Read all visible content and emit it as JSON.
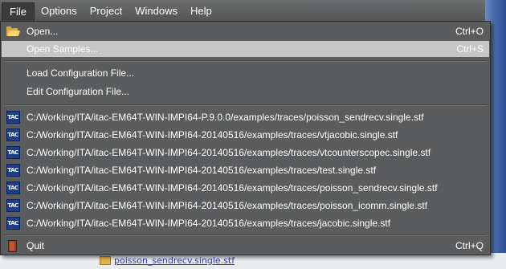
{
  "menubar": {
    "items": [
      {
        "label": "File",
        "active": true
      },
      {
        "label": "Options"
      },
      {
        "label": "Project"
      },
      {
        "label": "Windows"
      },
      {
        "label": "Help"
      }
    ]
  },
  "file_menu": {
    "open": {
      "label": "Open...",
      "shortcut": "Ctrl+O",
      "icon": "folder-open-icon"
    },
    "open_samples": {
      "label": "Open Samples...",
      "shortcut": "Ctrl+S",
      "highlighted": true
    },
    "load_config": {
      "label": "Load Configuration File..."
    },
    "edit_config": {
      "label": "Edit Configuration File..."
    },
    "recent_files": [
      {
        "label": "C:/Working/ITA/itac-EM64T-WIN-IMPI64-P.9.0.0/examples/traces/poisson_sendrecv.single.stf"
      },
      {
        "label": "C:/Working/ITA/itac-EM64T-WIN-IMPI64-20140516/examples/traces/vtjacobic.single.stf"
      },
      {
        "label": "C:/Working/ITA/itac-EM64T-WIN-IMPI64-20140516/examples/traces/vtcounterscopec.single.stf"
      },
      {
        "label": "C:/Working/ITA/itac-EM64T-WIN-IMPI64-20140516/examples/traces/test.single.stf"
      },
      {
        "label": "C:/Working/ITA/itac-EM64T-WIN-IMPI64-20140516/examples/traces/poisson_sendrecv.single.stf"
      },
      {
        "label": "C:/Working/ITA/itac-EM64T-WIN-IMPI64-20140516/examples/traces/poisson_icomm.single.stf"
      },
      {
        "label": "C:/Working/ITA/itac-EM64T-WIN-IMPI64-20140516/examples/traces/jacobic.single.stf"
      }
    ],
    "recent_icon_text": "TAC",
    "quit": {
      "label": "Quit",
      "shortcut": "Ctrl+Q",
      "icon": "exit-door-icon"
    }
  },
  "background": {
    "file_item": "poisson_sendrecv.single.stf"
  }
}
